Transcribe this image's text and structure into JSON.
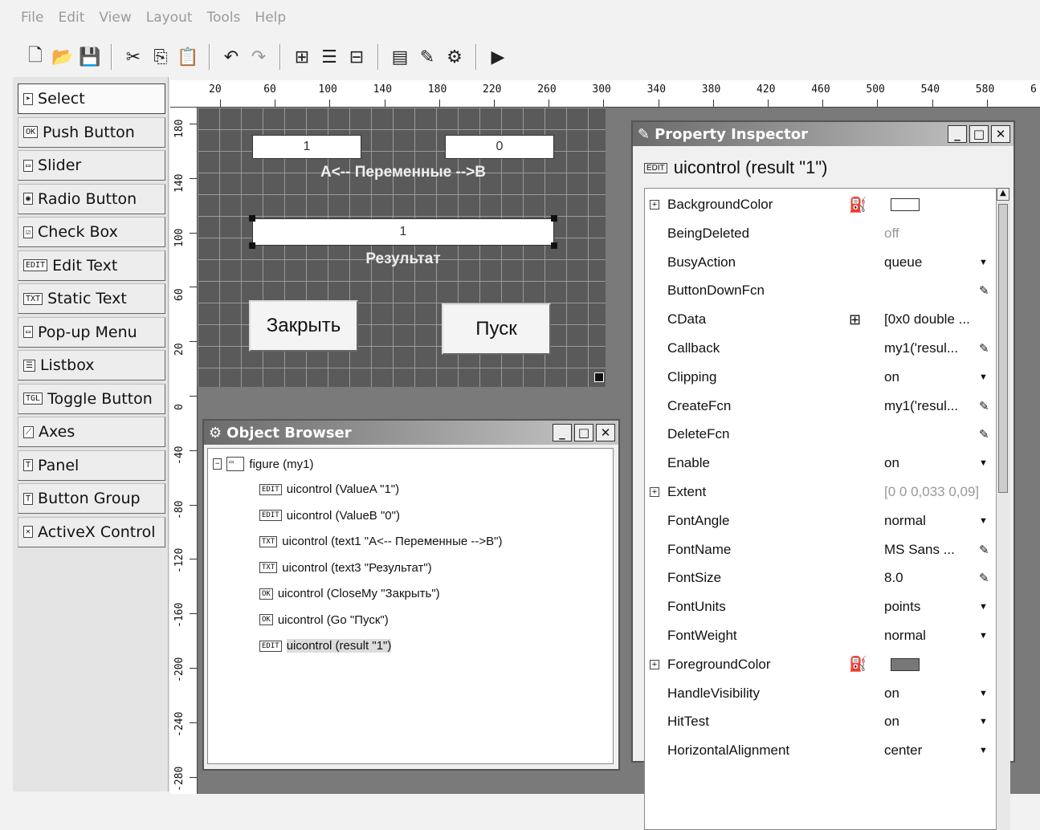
{
  "menu": [
    "File",
    "Edit",
    "View",
    "Layout",
    "Tools",
    "Help"
  ],
  "toolbar_icons": [
    "new-icon",
    "open-icon",
    "save-icon",
    "cut-icon",
    "copy-icon",
    "paste-icon",
    "undo-icon",
    "redo-icon",
    "align-icon",
    "menu-editor-icon",
    "tab-order-icon",
    "mfile-editor-icon",
    "property-inspector-icon",
    "object-browser-icon",
    "run-icon"
  ],
  "palette": [
    {
      "label": "Select",
      "icon": "arrow-icon",
      "glyph": "➤",
      "selected": true
    },
    {
      "label": "Push Button",
      "icon": "push-button-icon",
      "glyph": "OK"
    },
    {
      "label": "Slider",
      "icon": "slider-icon",
      "glyph": "▭"
    },
    {
      "label": "Radio Button",
      "icon": "radio-icon",
      "glyph": "◉"
    },
    {
      "label": "Check Box",
      "icon": "checkbox-icon",
      "glyph": "☑"
    },
    {
      "label": "Edit Text",
      "icon": "edit-text-icon",
      "glyph": "EDIT"
    },
    {
      "label": "Static Text",
      "icon": "static-text-icon",
      "glyph": "TXT"
    },
    {
      "label": "Pop-up Menu",
      "icon": "popup-icon",
      "glyph": "▭"
    },
    {
      "label": "Listbox",
      "icon": "listbox-icon",
      "glyph": "☰"
    },
    {
      "label": "Toggle Button",
      "icon": "toggle-icon",
      "glyph": "TGL"
    },
    {
      "label": "Axes",
      "icon": "axes-icon",
      "glyph": "⟋"
    },
    {
      "label": "Panel",
      "icon": "panel-icon",
      "glyph": "T"
    },
    {
      "label": "Button Group",
      "icon": "button-group-icon",
      "glyph": "T"
    },
    {
      "label": "ActiveX Control",
      "icon": "activex-icon",
      "glyph": "✕"
    }
  ],
  "hruler": [
    "20",
    "60",
    "100",
    "140",
    "180",
    "220",
    "260",
    "300",
    "340",
    "380",
    "420",
    "460",
    "500",
    "540",
    "580",
    "6"
  ],
  "vruler": [
    "180",
    "140",
    "100",
    "60",
    "20",
    "0",
    "-40",
    "-80",
    "-120",
    "-160",
    "-200",
    "-240",
    "-280"
  ],
  "figure": {
    "valueA": "1",
    "valueB": "0",
    "text1": "A<-- Переменные -->B",
    "result": "1",
    "text3": "Результат",
    "close_button": "Закрыть",
    "go_button": "Пуск"
  },
  "object_browser": {
    "title": "Object Browser",
    "root": "figure (my1)",
    "items": [
      {
        "icon": "EDIT",
        "label": "uicontrol (ValueA \"1\")"
      },
      {
        "icon": "EDIT",
        "label": "uicontrol (ValueB \"0\")"
      },
      {
        "icon": "TXT",
        "label": "uicontrol (text1 \"A<-- Переменные -->B\")"
      },
      {
        "icon": "TXT",
        "label": "uicontrol (text3 \"Результат\")"
      },
      {
        "icon": "OK",
        "label": "uicontrol (CloseMy \"Закрыть\")"
      },
      {
        "icon": "OK",
        "label": "uicontrol (Go \"Пуск\")"
      },
      {
        "icon": "EDIT",
        "label": "uicontrol (result \"1\")"
      }
    ]
  },
  "property_inspector": {
    "title": "Property Inspector",
    "subtitle": "uicontrol (result \"1\")",
    "rows": [
      {
        "name": "BackgroundColor",
        "value": "",
        "expand": true,
        "icon": "bucket",
        "swatch": "#ffffff"
      },
      {
        "name": "BeingDeleted",
        "value": "off",
        "grey": true
      },
      {
        "name": "BusyAction",
        "value": "queue",
        "dropdown": true
      },
      {
        "name": "ButtonDownFcn",
        "value": "",
        "edit": true
      },
      {
        "name": "CData",
        "value": "[0x0  double ...",
        "icon": "grid"
      },
      {
        "name": "Callback",
        "value": "my1('resul...",
        "edit": true
      },
      {
        "name": "Clipping",
        "value": "on",
        "dropdown": true
      },
      {
        "name": "CreateFcn",
        "value": "my1('resul...",
        "edit": true
      },
      {
        "name": "DeleteFcn",
        "value": "",
        "edit": true
      },
      {
        "name": "Enable",
        "value": "on",
        "dropdown": true
      },
      {
        "name": "Extent",
        "value": "[0 0 0,033 0,09]",
        "expand": true,
        "grey": true
      },
      {
        "name": "FontAngle",
        "value": "normal",
        "dropdown": true
      },
      {
        "name": "FontName",
        "value": "MS Sans ...",
        "edit": true
      },
      {
        "name": "FontSize",
        "value": "8.0",
        "edit": true
      },
      {
        "name": "FontUnits",
        "value": "points",
        "dropdown": true
      },
      {
        "name": "FontWeight",
        "value": "normal",
        "dropdown": true
      },
      {
        "name": "ForegroundColor",
        "value": "",
        "expand": true,
        "icon": "bucket",
        "swatch": "#777777"
      },
      {
        "name": "HandleVisibility",
        "value": "on",
        "dropdown": true
      },
      {
        "name": "HitTest",
        "value": "on",
        "dropdown": true
      },
      {
        "name": "HorizontalAlignment",
        "value": "center",
        "dropdown": true
      }
    ]
  }
}
